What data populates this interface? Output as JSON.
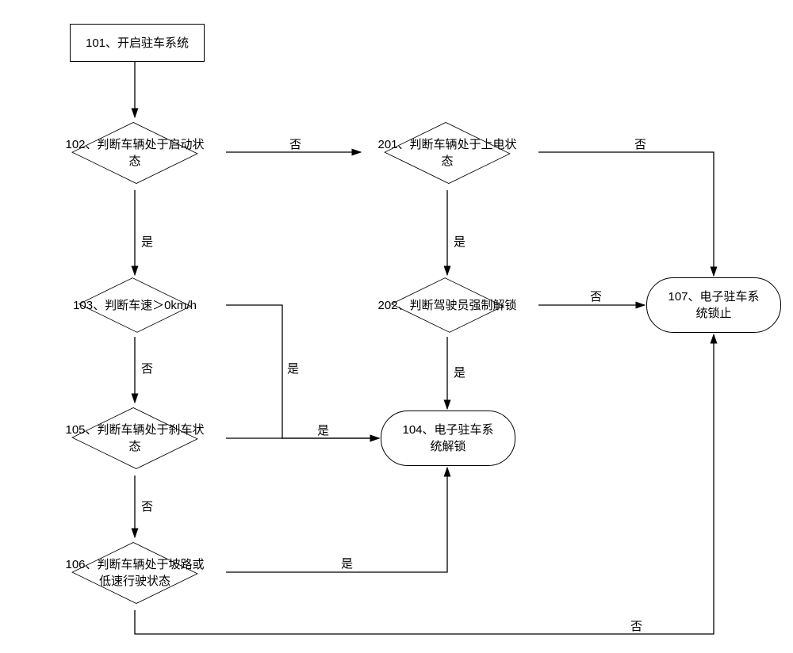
{
  "chart_data": {
    "type": "flowchart",
    "nodes": {
      "n101": "101、开启驻车系统",
      "n102": "102、判断车辆处于启动状\n态",
      "n103": "103、判断车速＞0km/h",
      "n104": "104、电子驻车系\n统解锁",
      "n105": "105、判断车辆处于刹车状\n态",
      "n106": "106、判断车辆处于坡路或\n低速行驶状态",
      "n107": "107、电子驻车系\n统锁止",
      "n201": "201、判断车辆处于上电状\n态",
      "n202": "202、判断驾驶员强制解锁"
    },
    "labels": {
      "yes": "是",
      "no": "否"
    },
    "edges": [
      {
        "from": "n101",
        "to": "n102"
      },
      {
        "from": "n102",
        "to": "n103",
        "label": "yes"
      },
      {
        "from": "n102",
        "to": "n201",
        "label": "no"
      },
      {
        "from": "n201",
        "to": "n202",
        "label": "yes"
      },
      {
        "from": "n201",
        "to": "n107",
        "label": "no"
      },
      {
        "from": "n103",
        "to": "n104",
        "label": "yes"
      },
      {
        "from": "n103",
        "to": "n105",
        "label": "no"
      },
      {
        "from": "n105",
        "to": "n104",
        "label": "yes"
      },
      {
        "from": "n105",
        "to": "n106",
        "label": "no"
      },
      {
        "from": "n106",
        "to": "n104",
        "label": "yes"
      },
      {
        "from": "n106",
        "to": "n107",
        "label": "no"
      },
      {
        "from": "n202",
        "to": "n104",
        "label": "yes"
      },
      {
        "from": "n202",
        "to": "n107",
        "label": "no"
      }
    ]
  }
}
